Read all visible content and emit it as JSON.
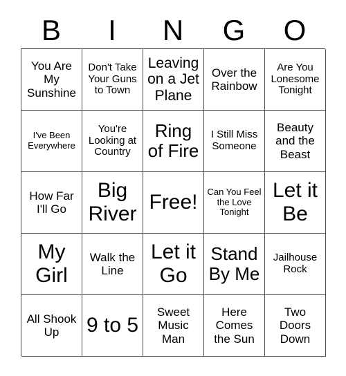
{
  "card": {
    "header_letters": [
      "B",
      "I",
      "N",
      "G",
      "O"
    ],
    "columns": 5,
    "rows": 5,
    "free_space_label": "Free!",
    "free_space_position": {
      "row": 3,
      "column": 3
    },
    "border_color": "#4d4d4d",
    "text_color": "#000000",
    "background_color": "#ffffff",
    "cells": [
      {
        "text": "You Are My Sunshine",
        "size": "md"
      },
      {
        "text": "Don't Take Your Guns to Town",
        "size": "sm"
      },
      {
        "text": "Leaving on a Jet Plane",
        "size": "lg"
      },
      {
        "text": "Over the Rainbow",
        "size": "md"
      },
      {
        "text": "Are You Lonesome Tonight",
        "size": "sm"
      },
      {
        "text": "I've Been Everywhere",
        "size": "xs"
      },
      {
        "text": "You're Looking at Country",
        "size": "sm"
      },
      {
        "text": "Ring of Fire",
        "size": "xl"
      },
      {
        "text": "I Still Miss Someone",
        "size": "sm"
      },
      {
        "text": "Beauty and the Beast",
        "size": "md"
      },
      {
        "text": "How Far I'll Go",
        "size": "md"
      },
      {
        "text": "Big River",
        "size": "xxl"
      },
      {
        "text": "Free!",
        "size": "xxl"
      },
      {
        "text": "Can You Feel the Love Tonight",
        "size": "xs"
      },
      {
        "text": "Let it Be",
        "size": "xxl"
      },
      {
        "text": "My Girl",
        "size": "xxl"
      },
      {
        "text": "Walk the Line",
        "size": "md"
      },
      {
        "text": "Let it Go",
        "size": "xxl"
      },
      {
        "text": "Stand By Me",
        "size": "xl"
      },
      {
        "text": "Jailhouse Rock",
        "size": "sm"
      },
      {
        "text": "All Shook Up",
        "size": "md"
      },
      {
        "text": "9 to 5",
        "size": "xxl"
      },
      {
        "text": "Sweet Music Man",
        "size": "md"
      },
      {
        "text": "Here Comes the Sun",
        "size": "md"
      },
      {
        "text": "Two Doors Down",
        "size": "md"
      }
    ]
  }
}
